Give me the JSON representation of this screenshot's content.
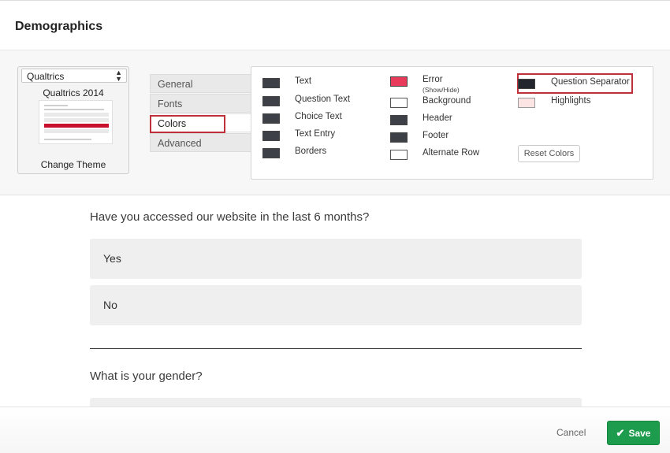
{
  "header": {
    "title": "Demographics"
  },
  "theme": {
    "select_value": "Qualtrics",
    "name": "Qualtrics 2014",
    "change_label": "Change Theme"
  },
  "tabs": [
    {
      "label": "General"
    },
    {
      "label": "Fonts"
    },
    {
      "label": "Colors"
    },
    {
      "label": "Advanced"
    }
  ],
  "colors": {
    "col1": [
      {
        "label": "Text",
        "color": "#3d4047"
      },
      {
        "label": "Question Text",
        "color": "#3d4047"
      },
      {
        "label": "Choice Text",
        "color": "#3d4047"
      },
      {
        "label": "Text Entry",
        "color": "#3d4047"
      },
      {
        "label": "Borders",
        "color": "#3d4047"
      }
    ],
    "col2": [
      {
        "label": "Error",
        "sublabel": "(Show/Hide)",
        "color": "#e83a5a"
      },
      {
        "label": "Background",
        "color": "#ffffff"
      },
      {
        "label": "Header",
        "color": "#3d4047"
      },
      {
        "label": "Footer",
        "color": "#3d4047"
      },
      {
        "label": "Alternate Row",
        "color": "#ffffff"
      }
    ],
    "col3": [
      {
        "label": "Question Separator",
        "color": "#24262d"
      },
      {
        "label": "Highlights",
        "color": "#fde4e4"
      }
    ],
    "reset_label": "Reset Colors"
  },
  "preview": {
    "q1": {
      "text": "Have you accessed our website in the last 6 months?",
      "choices": [
        "Yes",
        "No"
      ]
    },
    "q2": {
      "text": "What is your gender?"
    }
  },
  "footer": {
    "cancel_label": "Cancel",
    "save_label": "Save"
  },
  "accent": {
    "save_green": "#1e9c4d",
    "highlight_red": "#c0303b"
  }
}
